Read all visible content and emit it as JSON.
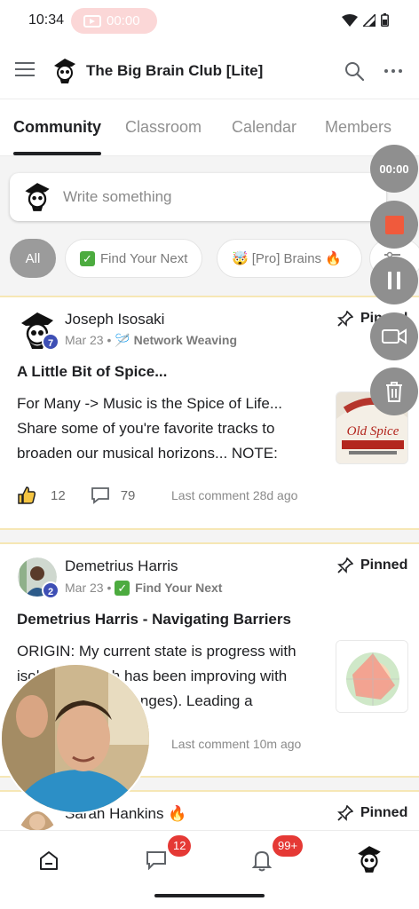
{
  "status_bar": {
    "time": "10:34",
    "recording_timer": "00:00"
  },
  "app_bar": {
    "title": "The Big Brain Club [Lite]"
  },
  "tabs": [
    {
      "label": "Community",
      "active": true
    },
    {
      "label": "Classroom"
    },
    {
      "label": "Calendar"
    },
    {
      "label": "Members"
    }
  ],
  "composer": {
    "placeholder": "Write something"
  },
  "filter_chips": [
    {
      "label": "All",
      "active": true
    },
    {
      "label": "Find Your Next",
      "emoji": "✅"
    },
    {
      "label": "[Pro] Brains",
      "emoji": "🤯",
      "suffix_emoji": "🔥"
    }
  ],
  "recording_controls": {
    "timer": "00:00",
    "buttons": [
      "stop-icon",
      "pause-icon",
      "camera-icon",
      "trash-icon"
    ]
  },
  "posts": [
    {
      "author": "Joseph Isosaki",
      "level": "7",
      "date": "Mar 23",
      "category_emoji": "🪡",
      "category": "Network Weaving",
      "pinned_label": "Pinned",
      "title": "A Little Bit of Spice...",
      "body": "For Many -> Music is the Spice of Life... Share some of you're favorite tracks to broaden our musical horizons... NOTE:",
      "likes": "12",
      "comments": "79",
      "last_comment": "Last comment 28d ago",
      "thumbnail": "Old Spice product image"
    },
    {
      "author": "Demetrius Harris",
      "level": "2",
      "date": "Mar 23",
      "category_emoji": "✅",
      "category": "Find Your Next",
      "pinned_label": "Pinned",
      "title": "Demetrius Harris - Navigating Barriers",
      "body": "ORIGIN: My current state is progress with isolation (which has been improving with environmental changes). Leading a",
      "last_comment": "Last comment 10m ago",
      "thumbnail": "radar chart"
    },
    {
      "author": "Sarah Hankins",
      "author_suffix": "🔥",
      "pinned_label": "Pinned"
    }
  ],
  "bottom_nav": {
    "items": [
      {
        "icon": "home-icon"
      },
      {
        "icon": "chat-icon",
        "badge": "12"
      },
      {
        "icon": "bell-icon",
        "badge": "99+"
      },
      {
        "icon": "profile-avatar"
      }
    ]
  },
  "colors": {
    "accent_dark": "#202124",
    "badge_red": "#e53935",
    "record_red": "#f05a3c",
    "level_badge": "#3e4fb5",
    "divider_gold": "#f6e7b5"
  }
}
